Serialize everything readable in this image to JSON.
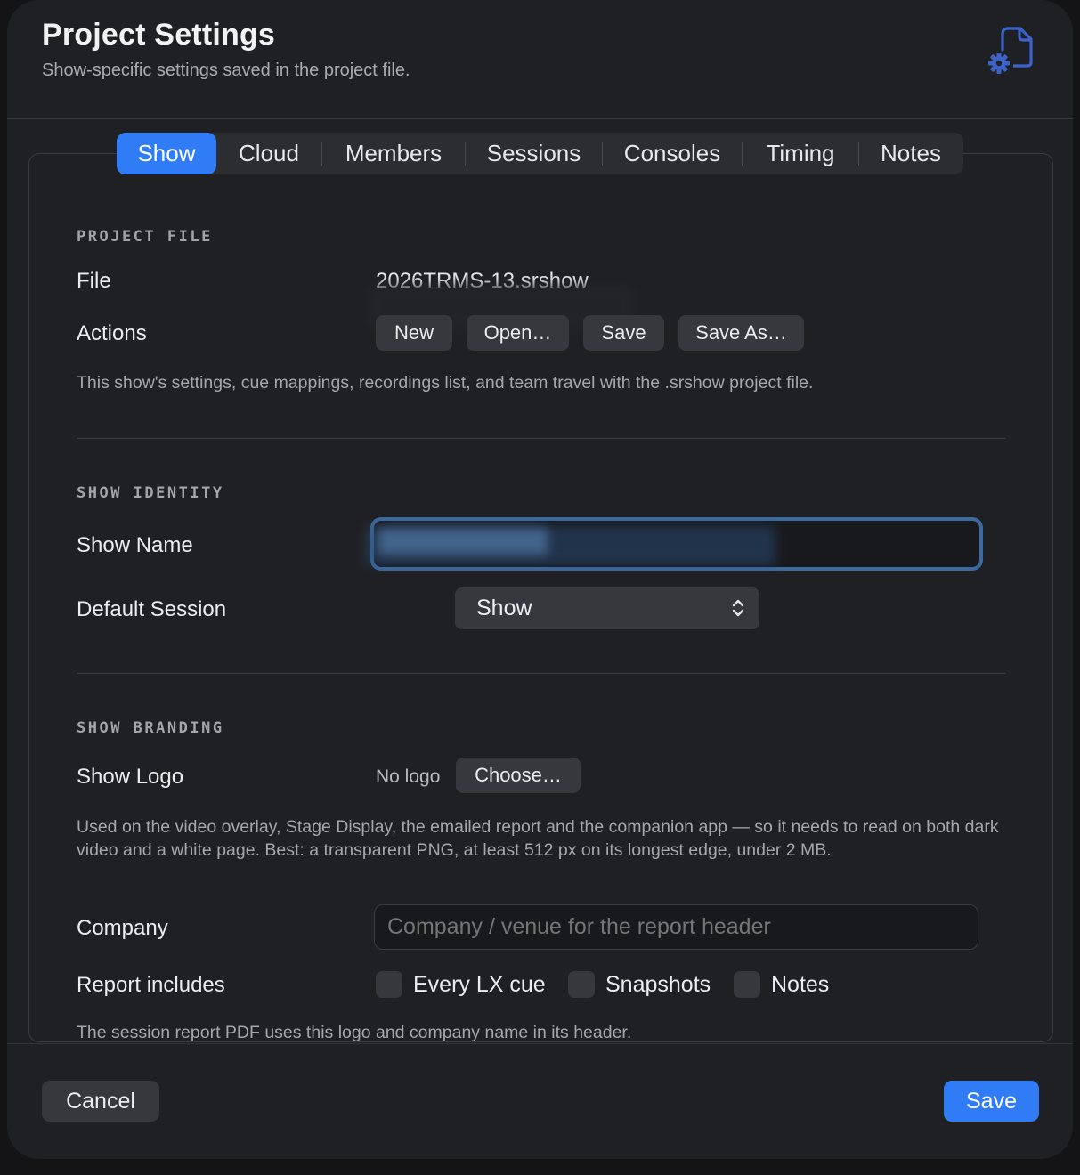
{
  "header": {
    "title": "Project Settings",
    "subtitle": "Show-specific settings saved in the project file.",
    "icon": "document-gear-icon"
  },
  "tabs": [
    {
      "label": "Show",
      "active": true
    },
    {
      "label": "Cloud",
      "active": false
    },
    {
      "label": "Members",
      "active": false
    },
    {
      "label": "Sessions",
      "active": false
    },
    {
      "label": "Consoles",
      "active": false
    },
    {
      "label": "Timing",
      "active": false
    },
    {
      "label": "Notes",
      "active": false
    }
  ],
  "project_file": {
    "section_title": "PROJECT FILE",
    "file_label": "File",
    "file_value": "2026TRMS-13.srshow",
    "actions_label": "Actions",
    "buttons": {
      "new": "New",
      "open": "Open…",
      "save": "Save",
      "save_as": "Save As…"
    },
    "help": "This show's settings, cue mappings, recordings list, and team travel with the .srshow project file."
  },
  "show_identity": {
    "section_title": "SHOW IDENTITY",
    "show_name_label": "Show Name",
    "show_name_value": "",
    "default_session_label": "Default Session",
    "default_session_value": "Show"
  },
  "show_branding": {
    "section_title": "SHOW BRANDING",
    "logo_label": "Show Logo",
    "logo_status": "No logo",
    "choose_button": "Choose…",
    "help": "Used on the video overlay, Stage Display, the emailed report and the companion app — so it needs to read on both dark video and a white page. Best: a transparent PNG, at least 512 px on its longest edge, under 2 MB.",
    "company_label": "Company",
    "company_placeholder": "Company / venue for the report header",
    "report_includes_label": "Report includes",
    "report_options": [
      {
        "label": "Every LX cue",
        "checked": false
      },
      {
        "label": "Snapshots",
        "checked": false
      },
      {
        "label": "Notes",
        "checked": false
      }
    ],
    "report_help": "The session report PDF uses this logo and company name in its header."
  },
  "footer": {
    "cancel": "Cancel",
    "save": "Save"
  },
  "colors": {
    "accent": "#2f7cf6",
    "icon": "#3d63c9",
    "focus_ring": "#3c6a9f"
  }
}
